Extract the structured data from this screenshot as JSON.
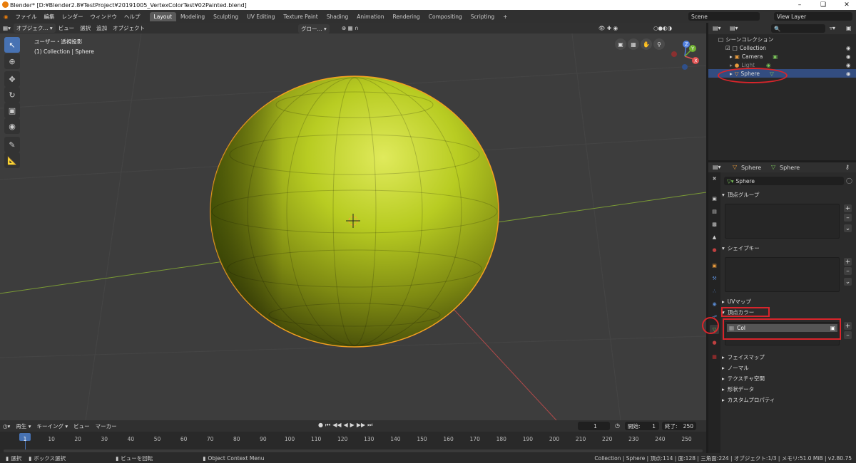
{
  "title_bar": {
    "text": "Blender* [D:¥Blender2.8¥TestProject¥20191005_VertexColorTest¥02Painted.blend]",
    "min": "–",
    "max": "❑",
    "close": "✕"
  },
  "menu": {
    "items": [
      "ファイル",
      "編集",
      "レンダー",
      "ウィンドウ",
      "ヘルプ"
    ],
    "workspaces": [
      "Layout",
      "Modeling",
      "Sculpting",
      "UV Editing",
      "Texture Paint",
      "Shading",
      "Animation",
      "Rendering",
      "Compositing",
      "Scripting"
    ],
    "add_tab": "+",
    "scene": "Scene",
    "view_layer": "View Layer"
  },
  "viewport": {
    "mode": "オブジェク...",
    "view": "ビュー",
    "select": "選択",
    "add": "追加",
    "object": "オブジェクト",
    "transform": "グロー...",
    "info_line1": "ユーザー・透視投影",
    "info_line2": "(1) Collection | Sphere",
    "gizmo": {
      "x": "X",
      "y": "Y",
      "z": "Z"
    }
  },
  "outliner": {
    "root": "シーンコレクション",
    "collection": "Collection",
    "items": [
      "Camera",
      "Light",
      "Sphere"
    ]
  },
  "properties": {
    "object_name": "Sphere",
    "data_name": "Sphere",
    "mesh_name": "Sphere",
    "sections": {
      "vertex_groups": "頂点グループ",
      "shape_keys": "シェイプキー",
      "uv_maps": "UVマップ",
      "vertex_colors": "頂点カラー",
      "face_maps": "フェイスマップ",
      "normals": "ノーマル",
      "texture_space": "テクスチャ空間",
      "shape_data": "形状データ",
      "custom_props": "カスタムプロパティ"
    },
    "vertex_color_layer": "Col"
  },
  "timeline": {
    "play": "再生",
    "keying": "キーイング",
    "view": "ビュー",
    "marker": "マーカー",
    "current": "1",
    "start_label": "開始:",
    "start": "1",
    "end_label": "終了:",
    "end": "250",
    "ticks": [
      "1",
      "10",
      "20",
      "30",
      "40",
      "50",
      "60",
      "70",
      "80",
      "90",
      "100",
      "110",
      "120",
      "130",
      "140",
      "150",
      "160",
      "170",
      "180",
      "190",
      "200",
      "210",
      "220",
      "230",
      "240",
      "250"
    ]
  },
  "status": {
    "select": "選択",
    "box_select": "ボックス選択",
    "rotate_view": "ビューを回転",
    "context_menu": "Object Context Menu",
    "stats": "Collection | Sphere | 頂点:114 | 面:128 | 三角面:224 | オブジェクト:1/3 | メモリ:51.0 MiB | v2.80.75"
  },
  "colors": {
    "accent": "#4772b3",
    "highlight": "#d9252b",
    "selection": "#f5a020",
    "sphere": "#b8d020"
  }
}
